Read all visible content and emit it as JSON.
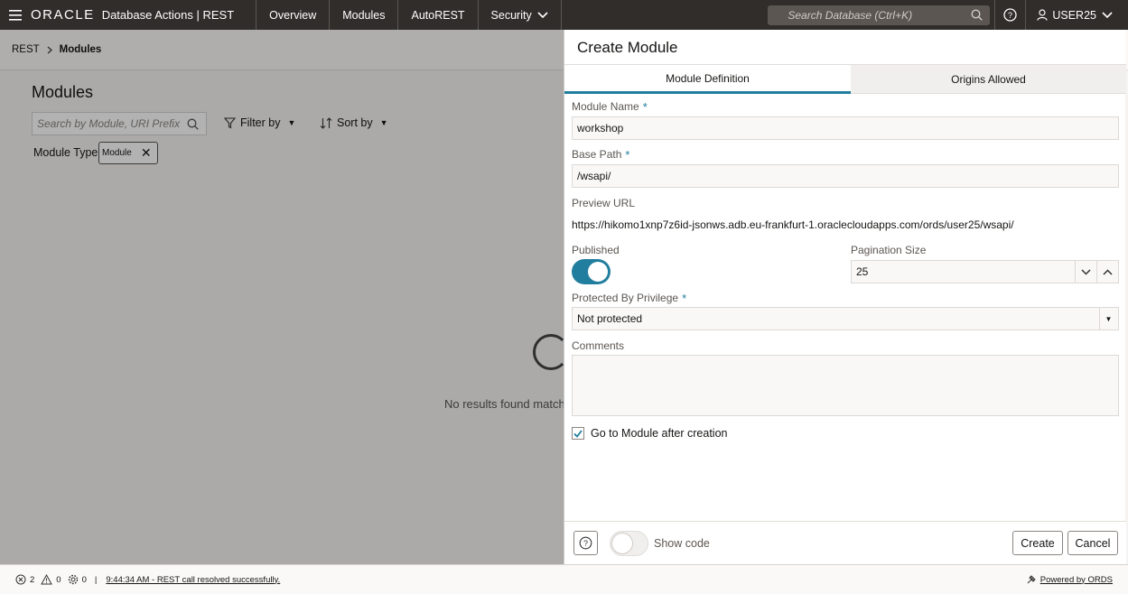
{
  "topbar": {
    "brand": "ORACLE",
    "app": "Database Actions |  REST",
    "nav": [
      "Overview",
      "Modules",
      "AutoREST",
      "Security"
    ],
    "search_placeholder": "Search Database (Ctrl+K)",
    "user": "USER25"
  },
  "breadcrumb": {
    "root": "REST",
    "current": "Modules"
  },
  "main": {
    "title": "Modules",
    "search_placeholder": "Search by Module, URI Prefix",
    "filter_label": "Filter by",
    "sort_label": "Sort by",
    "type_label": "Module Type",
    "type_chip": "Module",
    "no_results": "No results found matchin"
  },
  "drawer": {
    "title": "Create Module",
    "tabs": [
      "Module Definition",
      "Origins Allowed"
    ],
    "module_name_label": "Module Name",
    "module_name_value": "workshop",
    "base_path_label": "Base Path",
    "base_path_value": "/wsapi/",
    "preview_url_label": "Preview URL",
    "preview_url_value": "https://hikomo1xnp7z6id-jsonws.adb.eu-frankfurt-1.oraclecloudapps.com/ords/user25/wsapi/",
    "published_label": "Published",
    "published": true,
    "pagination_label": "Pagination Size",
    "pagination_value": "25",
    "privilege_label": "Protected By Privilege",
    "privilege_value": "Not protected",
    "comments_label": "Comments",
    "comments_value": "",
    "goto_label": "Go to Module after creation",
    "goto_checked": true,
    "show_code_label": "Show code",
    "create_label": "Create",
    "cancel_label": "Cancel",
    "required_mark": "*"
  },
  "statusbar": {
    "errors": "2",
    "warnings": "0",
    "settings_count": "0",
    "separator": "|",
    "message": "9:44:34 AM - REST call resolved successfully.",
    "powered": "Powered by ORDS"
  },
  "colors": {
    "accent": "#227e9e",
    "topbar": "#312d2a"
  }
}
